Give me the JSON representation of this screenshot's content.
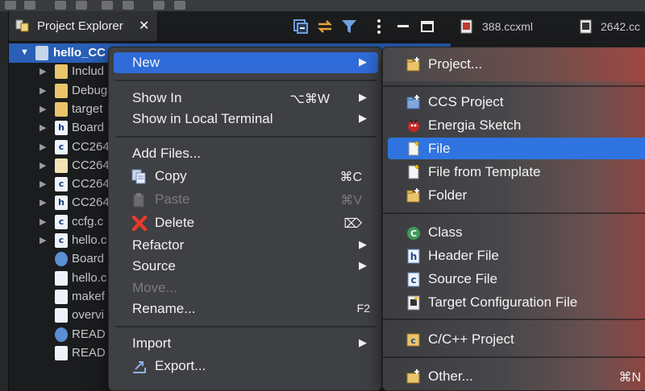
{
  "explorer": {
    "title": "Project Explorer",
    "close": "✕",
    "tools": [
      "collapse-all-icon",
      "link-with-editor-icon",
      "filter-icon",
      "view-menu-icon",
      "minimize-icon",
      "maximize-icon"
    ]
  },
  "tree": [
    {
      "label": "hello_CC",
      "arrow": "▼",
      "icon": "project-icon",
      "selected": true
    },
    {
      "label": "Includ",
      "arrow": "▶",
      "icon": "includes-icon"
    },
    {
      "label": "Debug",
      "arrow": "▶",
      "icon": "folder-icon"
    },
    {
      "label": "target",
      "arrow": "▶",
      "icon": "folder-icon"
    },
    {
      "label": "Board",
      "arrow": "▶",
      "icon": "h-file-icon",
      "letter": "h"
    },
    {
      "label": "CC264",
      "arrow": "▶",
      "icon": "c-file-icon",
      "letter": "c"
    },
    {
      "label": "CC264",
      "arrow": "▶",
      "icon": "edit-file-icon"
    },
    {
      "label": "CC264",
      "arrow": "▶",
      "icon": "c-file-icon",
      "letter": "c"
    },
    {
      "label": "CC264",
      "arrow": "▶",
      "icon": "h-file-icon",
      "letter": "h"
    },
    {
      "label": "ccfg.c",
      "arrow": "▶",
      "icon": "c-file-icon",
      "letter": "c"
    },
    {
      "label": "hello.c",
      "arrow": "▶",
      "icon": "c-file-icon",
      "letter": "c"
    },
    {
      "label": "Board",
      "arrow": "",
      "icon": "globe-icon"
    },
    {
      "label": "hello.c",
      "arrow": "",
      "icon": "text-file-icon"
    },
    {
      "label": "makef",
      "arrow": "",
      "icon": "makefile-icon"
    },
    {
      "label": "overvi",
      "arrow": "",
      "icon": "script-file-icon"
    },
    {
      "label": "READ",
      "arrow": "",
      "icon": "globe-icon"
    },
    {
      "label": "READ",
      "arrow": "",
      "icon": "text-file-icon"
    }
  ],
  "editor_tabs": [
    {
      "label": "388.ccxml",
      "icon": "ccxml-icon"
    },
    {
      "label": "2642.cc",
      "icon": "ccxml-icon"
    }
  ],
  "context_menu": {
    "new": "New",
    "show_in": "Show In",
    "show_in_keys": "⌥⌘W",
    "show_in_terminal": "Show in Local Terminal",
    "add_files": "Add Files...",
    "copy": "Copy",
    "copy_keys": "⌘C",
    "paste": "Paste",
    "paste_keys": "⌘V",
    "delete": "Delete",
    "delete_keys": "⌦",
    "refactor": "Refactor",
    "source": "Source",
    "move": "Move...",
    "rename": "Rename...",
    "rename_keys": "F2",
    "import": "Import",
    "export": "Export..."
  },
  "submenu": {
    "project": "Project...",
    "ccs_project": "CCS Project",
    "energia_sketch": "Energia Sketch",
    "file": "File",
    "file_from_template": "File from Template",
    "folder": "Folder",
    "class": "Class",
    "header_file": "Header File",
    "source_file": "Source File",
    "target_config": "Target Configuration File",
    "cpp_project": "C/C++ Project",
    "other": "Other...",
    "other_keys": "⌘N"
  },
  "colors": {
    "selection": "#2a5fb8",
    "menu_highlight": "#2f6bd9",
    "menu_bg": "#3f4043"
  }
}
